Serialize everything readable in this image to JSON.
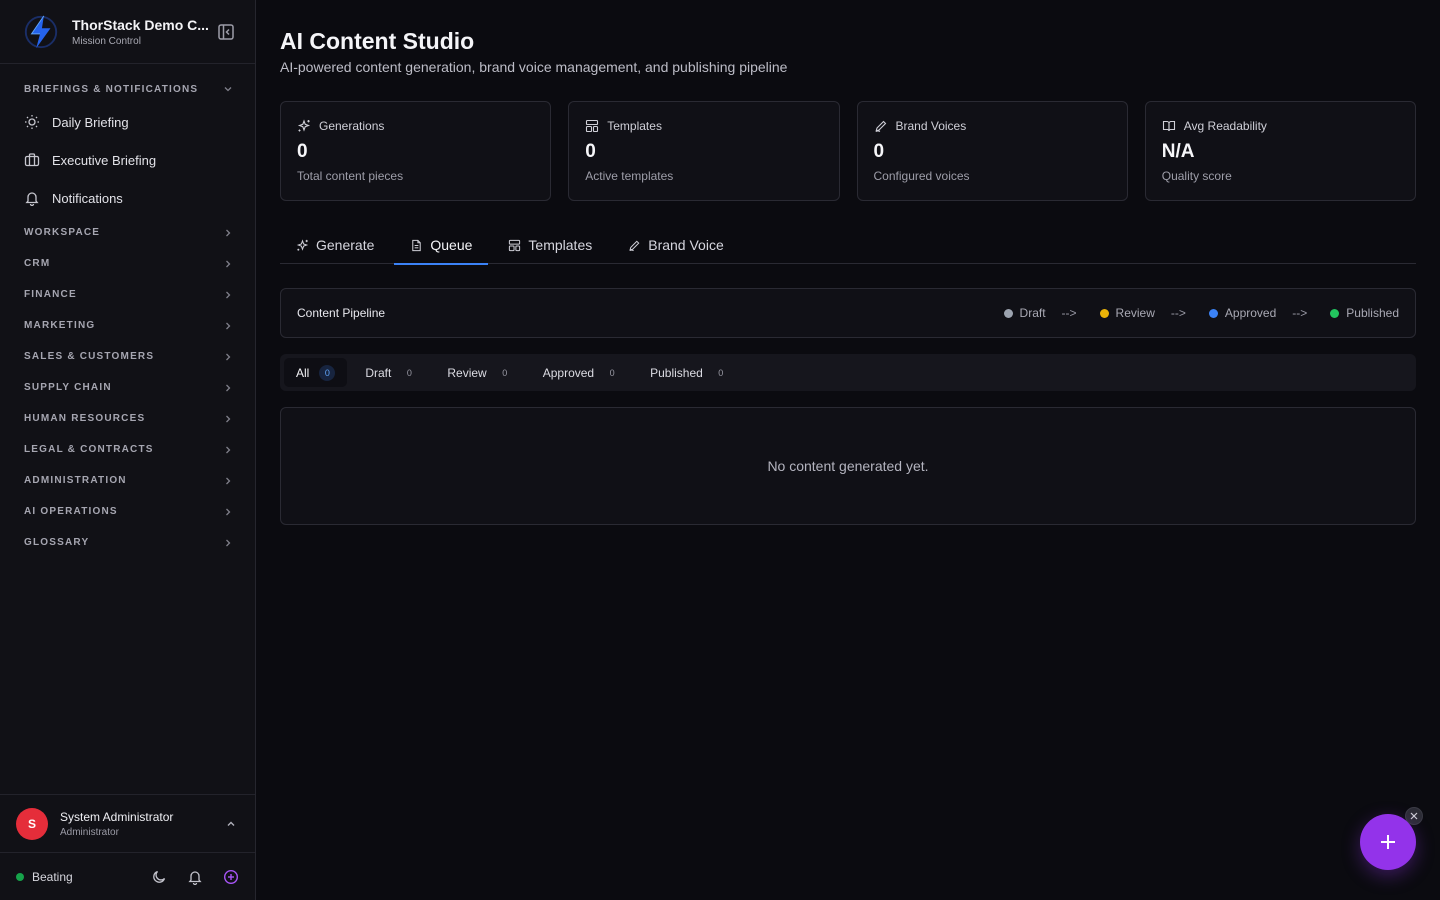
{
  "sidebar": {
    "org_name": "ThorStack Demo C...",
    "org_sub": "Mission Control",
    "open_section": "BRIEFINGS & NOTIFICATIONS",
    "items": [
      {
        "label": "Daily Briefing",
        "icon": "sun-icon"
      },
      {
        "label": "Executive Briefing",
        "icon": "briefcase-icon"
      },
      {
        "label": "Notifications",
        "icon": "bell-icon"
      }
    ],
    "sections": [
      "WORKSPACE",
      "CRM",
      "FINANCE",
      "MARKETING",
      "SALES & CUSTOMERS",
      "SUPPLY CHAIN",
      "HUMAN RESOURCES",
      "LEGAL & CONTRACTS",
      "ADMINISTRATION",
      "AI OPERATIONS",
      "GLOSSARY"
    ],
    "user": {
      "initial": "S",
      "name": "System Administrator",
      "role": "Administrator"
    },
    "status": "Beating"
  },
  "page": {
    "title": "AI Content Studio",
    "subtitle": "AI-powered content generation, brand voice management, and publishing pipeline"
  },
  "stats": [
    {
      "label": "Generations",
      "value": "0",
      "note": "Total content pieces",
      "icon": "sparkles-icon"
    },
    {
      "label": "Templates",
      "value": "0",
      "note": "Active templates",
      "icon": "layout-template-icon"
    },
    {
      "label": "Brand Voices",
      "value": "0",
      "note": "Configured voices",
      "icon": "pen-icon"
    },
    {
      "label": "Avg Readability",
      "value": "N/A",
      "note": "Quality score",
      "icon": "book-open-icon"
    }
  ],
  "tabs": [
    {
      "label": "Generate",
      "icon": "sparkles-icon"
    },
    {
      "label": "Queue",
      "icon": "file-text-icon",
      "active": true
    },
    {
      "label": "Templates",
      "icon": "layout-template-icon"
    },
    {
      "label": "Brand Voice",
      "icon": "pen-icon"
    }
  ],
  "pipeline": {
    "title": "Content Pipeline",
    "arrow": "-->",
    "stages": [
      {
        "label": "Draft",
        "color": "#9ca3af"
      },
      {
        "label": "Review",
        "color": "#eab308"
      },
      {
        "label": "Approved",
        "color": "#3b82f6"
      },
      {
        "label": "Published",
        "color": "#22c55e"
      }
    ]
  },
  "filters": [
    {
      "label": "All",
      "count": "0",
      "active": true
    },
    {
      "label": "Draft",
      "count": "0"
    },
    {
      "label": "Review",
      "count": "0"
    },
    {
      "label": "Approved",
      "count": "0"
    },
    {
      "label": "Published",
      "count": "0"
    }
  ],
  "empty_message": "No content generated yet.",
  "colors": {
    "accent": "#3b82f6",
    "fab": "#9333ea",
    "avatar": "#e52d3a",
    "status": "#16a34a"
  }
}
